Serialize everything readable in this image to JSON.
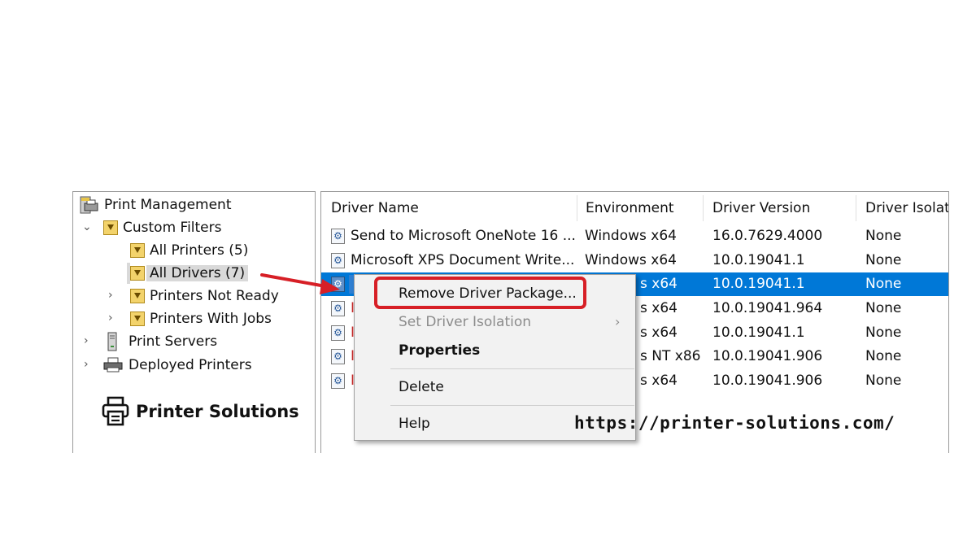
{
  "tree": {
    "items": [
      {
        "label": "Print Management",
        "icon": "print-management-icon"
      },
      {
        "label": "Custom Filters",
        "icon": "filter-folder-icon",
        "chevron": "expanded"
      },
      {
        "label": "All Printers (5)",
        "icon": "filter-icon"
      },
      {
        "label": "All Drivers (7)",
        "icon": "filter-icon",
        "selected": true
      },
      {
        "label": "Printers Not Ready",
        "icon": "filter-icon",
        "chevron": "collapsed"
      },
      {
        "label": "Printers With Jobs",
        "icon": "filter-icon",
        "chevron": "collapsed"
      },
      {
        "label": "Print Servers",
        "icon": "server-icon",
        "chevron": "collapsed"
      },
      {
        "label": "Deployed Printers",
        "icon": "printer-icon",
        "chevron": "collapsed"
      }
    ]
  },
  "brand": {
    "label": "Printer Solutions",
    "icon": "printer-icon"
  },
  "table": {
    "columns": [
      "Driver Name",
      "Environment",
      "Driver Version",
      "Driver Isolati"
    ],
    "rows": [
      {
        "name": "Send to Microsoft OneNote 16 ...",
        "env": "Windows x64",
        "version": "16.0.7629.4000",
        "isolation": "None"
      },
      {
        "name": "Microsoft XPS Document Write...",
        "env": "Windows x64",
        "version": "10.0.19041.1",
        "isolation": "None"
      },
      {
        "name": "",
        "env": "s x64",
        "version": "10.0.19041.1",
        "isolation": "None",
        "selected": true
      },
      {
        "name": "I",
        "env": "s x64",
        "version": "10.0.19041.964",
        "isolation": "None"
      },
      {
        "name": "I",
        "env": "s x64",
        "version": "10.0.19041.1",
        "isolation": "None"
      },
      {
        "name": "I",
        "env": "s NT x86",
        "version": "10.0.19041.906",
        "isolation": "None"
      },
      {
        "name": "I",
        "env": "s x64",
        "version": "10.0.19041.906",
        "isolation": "None"
      }
    ]
  },
  "context_menu": {
    "remove": "Remove Driver Package...",
    "isolation": "Set Driver Isolation",
    "properties": "Properties",
    "delete": "Delete",
    "help": "Help"
  },
  "url": "https://printer-solutions.com/",
  "colors": {
    "accent": "#d71f26",
    "selection": "#0078d7"
  }
}
